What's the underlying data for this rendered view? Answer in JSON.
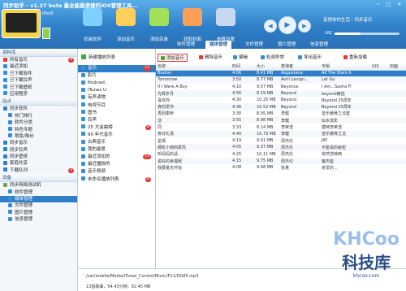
{
  "window": {
    "title": "同步助手 - v1.27 beta 最全能最便捷的iOS管理工具..."
  },
  "device": {
    "name": "iPod5"
  },
  "toolbar": [
    {
      "label": "安装软件",
      "color": "#7fd0ff"
    },
    {
      "label": "添加音乐",
      "color": "#ffcf5a"
    },
    {
      "label": "添加目录",
      "color": "#a2e05c"
    },
    {
      "label": "获取封面",
      "color": "#ff9e58"
    },
    {
      "label": "参数设置",
      "color": "#c7d8f0"
    }
  ],
  "player": {
    "song": "音悦你的生活 - 同步音乐",
    "lrc_label": "LRC",
    "volume": 0.4
  },
  "tabs": [
    "软件管理",
    "媒体管理",
    "文件管理",
    "图片管理",
    "信息管理"
  ],
  "active_tab": "媒体管理",
  "sidebar": {
    "section_resources": "资料库",
    "resources": [
      {
        "label": "所有音乐",
        "badge": "8",
        "color": "#e23a3a"
      },
      {
        "label": "最近添加",
        "badge": "",
        "color": "#3a8ed6"
      },
      {
        "label": "已下载软件",
        "badge": "",
        "color": "#3a8ed6"
      },
      {
        "label": "已下载铃声",
        "badge": "",
        "color": "#3a8ed6"
      },
      {
        "label": "已下载壁纸",
        "badge": "",
        "color": "#3a8ed6"
      },
      {
        "label": "应用程序",
        "badge": "",
        "color": "#3a8ed6"
      }
    ],
    "section_sites": "站点",
    "sites": [
      {
        "label": "同步软件",
        "sub": false,
        "color": "#2f7fc8"
      },
      {
        "label": "热门排行",
        "sub": true,
        "color": "#3a8ed6"
      },
      {
        "label": "软件分类",
        "sub": true,
        "color": "#3a8ed6"
      },
      {
        "label": "特色专题",
        "sub": true,
        "color": "#3a8ed6"
      },
      {
        "label": "限免/降价",
        "sub": true,
        "color": "#3a8ed6"
      },
      {
        "label": "同步音乐",
        "sub": false,
        "color": "#2f7fc8"
      },
      {
        "label": "同步铃声",
        "sub": false,
        "color": "#2f7fc8"
      },
      {
        "label": "同步壁纸",
        "sub": false,
        "color": "#2f7fc8"
      },
      {
        "label": "家庭共享",
        "sub": false,
        "color": "#2f7fc8"
      },
      {
        "label": "下载队列",
        "sub": false,
        "color": "#2f7fc8",
        "badge": "3"
      }
    ],
    "section_devices": "设备",
    "devices": [
      {
        "label": "同步网络测试机",
        "sub": false,
        "color": "#6aa84f"
      },
      {
        "label": "软件管理",
        "sub": true,
        "color": "#3a8ed6"
      },
      {
        "label": "媒体管理",
        "sub": true,
        "color": "#3a8ed6",
        "active": true
      },
      {
        "label": "文件管理",
        "sub": true,
        "color": "#3a8ed6"
      },
      {
        "label": "图片管理",
        "sub": true,
        "color": "#3a8ed6"
      },
      {
        "label": "信息管理",
        "sub": true,
        "color": "#3a8ed6"
      }
    ]
  },
  "media": {
    "new_list": "新建播放列表",
    "items": [
      {
        "label": "音乐",
        "badge": "13",
        "active": true
      },
      {
        "label": "影片",
        "badge": ""
      },
      {
        "label": "Podcast",
        "badge": ""
      },
      {
        "label": "iTunes U",
        "badge": ""
      },
      {
        "label": "有声读物",
        "badge": ""
      },
      {
        "label": "电视节目",
        "badge": ""
      },
      {
        "label": "图书",
        "badge": ""
      },
      {
        "label": "铃声",
        "badge": ""
      },
      {
        "label": "25 大金曲榜",
        "badge": "8"
      },
      {
        "label": "90 年代音乐",
        "badge": ""
      },
      {
        "label": "古典音乐",
        "badge": ""
      },
      {
        "label": "我的最爱",
        "badge": ""
      },
      {
        "label": "最近添加的",
        "badge": "13"
      },
      {
        "label": "最近播放的",
        "badge": ""
      },
      {
        "label": "音乐视频",
        "badge": ""
      },
      {
        "label": "未命名播放列表",
        "badge": "8"
      }
    ]
  },
  "actions": [
    {
      "label": "添加音乐",
      "color": "#3cae3c",
      "highlight": true
    },
    {
      "label": "删除音乐",
      "color": "#e23a3a",
      "highlight": false
    },
    {
      "label": "编辑",
      "color": "#3a8ed6",
      "highlight": false
    },
    {
      "label": "检测异常",
      "color": "#3a8ed6",
      "highlight": false
    },
    {
      "label": "导出音乐",
      "color": "#3a8ed6",
      "highlight": false
    },
    {
      "label": "重新加载",
      "color": "#e23a3a",
      "highlight": false
    }
  ],
  "table": {
    "columns": [
      "名称",
      "时间",
      "大小",
      "表演者",
      "专辑",
      "iOS",
      "封面"
    ],
    "rows": [
      {
        "name": "Boston",
        "time": "4:06",
        "size": "8.41 MB",
        "artist": "Augustana",
        "album": "All The Stars A",
        "selected": true
      },
      {
        "name": "Tomorrow",
        "time": "3:50",
        "size": "8.77 MB",
        "artist": "Avril Lavign...",
        "album": "Let Go"
      },
      {
        "name": "If I Were A Boy",
        "time": "4:10",
        "size": "9.57 MB",
        "artist": "Beyonce",
        "album": "I Am...Sasha Fi"
      },
      {
        "name": "光辉岁月",
        "time": "4:56",
        "size": "8.19 MB",
        "artist": "Beyond",
        "album": "beyond精选"
      },
      {
        "name": "喜欢你",
        "time": "4:30",
        "size": "10.25 MB",
        "artist": "Beyond",
        "album": "Beyond 25周年"
      },
      {
        "name": "真的爱你",
        "time": "4:36",
        "size": "10.52 MB",
        "artist": "Beyond",
        "album": "Beyond 25周年"
      },
      {
        "name": "再别康桥",
        "time": "3:30",
        "size": "8.05 MB",
        "artist": "李健",
        "album": "音乐傲骨之戈壁"
      },
      {
        "name": "活",
        "time": "3:55",
        "size": "8.98 MB",
        "artist": "李健",
        "album": "似水流年"
      },
      {
        "name": "同",
        "time": "3:33",
        "size": "8.14 MB",
        "artist": "李荣浩",
        "album": "模特李荣浩"
      },
      {
        "name": "夜日礼语",
        "time": "4:40",
        "size": "10.73 MB",
        "artist": "李健",
        "album": "音乐傲骨之戈"
      },
      {
        "name": "星晴",
        "time": "4:19",
        "size": "9.91 MB",
        "artist": "周杰伦",
        "album": "JAY"
      },
      {
        "name": "搁轮小雨四季风",
        "time": "4:05",
        "size": "9.37 MB",
        "artist": "周杰伦",
        "album": "不能说的秘密"
      },
      {
        "name": "听妈妈的话",
        "time": "4:25",
        "size": "10.11 MB",
        "artist": "周杰伦",
        "album": "依然范特西"
      },
      {
        "name": "说好的幸福呢",
        "time": "4:15",
        "size": "9.75 MB",
        "artist": "周杰伦",
        "album": "魔杰座"
      },
      {
        "name": "我要夏天开始",
        "time": "4:08",
        "size": "9.48 MB",
        "artist": "张悬",
        "album": "亲爱的..."
      }
    ]
  },
  "status": {
    "path": "/var/mobile/Media/iTunes_Control/Music/F11/DG85.mp3",
    "summary": "13首歌曲，54.43分钟，92.45 MB"
  },
  "watermark": {
    "brand": "KHCoo",
    "name": "科技库",
    "site": "khcoo.com"
  }
}
